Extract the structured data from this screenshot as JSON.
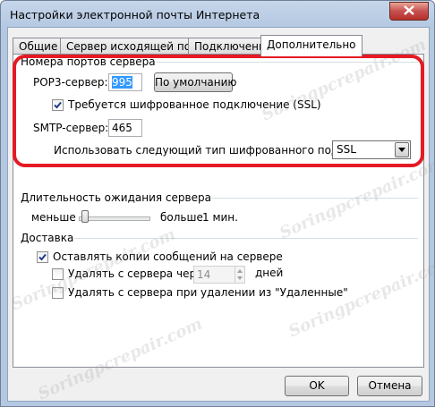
{
  "window": {
    "title": "Настройки электронной почты Интернета"
  },
  "tabs": [
    {
      "label": "Общие"
    },
    {
      "label": "Сервер исходящей почты"
    },
    {
      "label": "Подключение"
    },
    {
      "label": "Дополнительно"
    }
  ],
  "server_ports": {
    "group_label": "Номера портов сервера",
    "pop3_label": "POP3-сервер:",
    "pop3_value": "995",
    "default_button": "По умолчанию",
    "ssl_label": "Требуется шифрованное подключение (SSL)",
    "ssl_checked": true,
    "smtp_label": "SMTP-сервер:",
    "smtp_value": "465",
    "encryption_label": "Использовать следующий тип шифрованного подключения:",
    "encryption_value": "SSL"
  },
  "timeout": {
    "group_label": "Длительность ожидания сервера",
    "less": "меньше",
    "more": "больше",
    "value": "1 мин."
  },
  "delivery": {
    "group_label": "Доставка",
    "keep_copies_label": "Оставлять копии сообщений на сервере",
    "keep_copies_checked": true,
    "delete_after_label": "Удалять с сервера через",
    "delete_after_checked": false,
    "days_value": "14",
    "days_label": "дней",
    "delete_on_remove_label": "Удалять с сервера при удалении из \"Удаленные\"",
    "delete_on_remove_checked": false
  },
  "buttons": {
    "ok": "OK",
    "cancel": "Отмена"
  },
  "watermark": "Soringpcrepair.com",
  "colors": {
    "highlight": "#e51a24",
    "selection": "#3399ff",
    "close_button": "#c75050"
  }
}
